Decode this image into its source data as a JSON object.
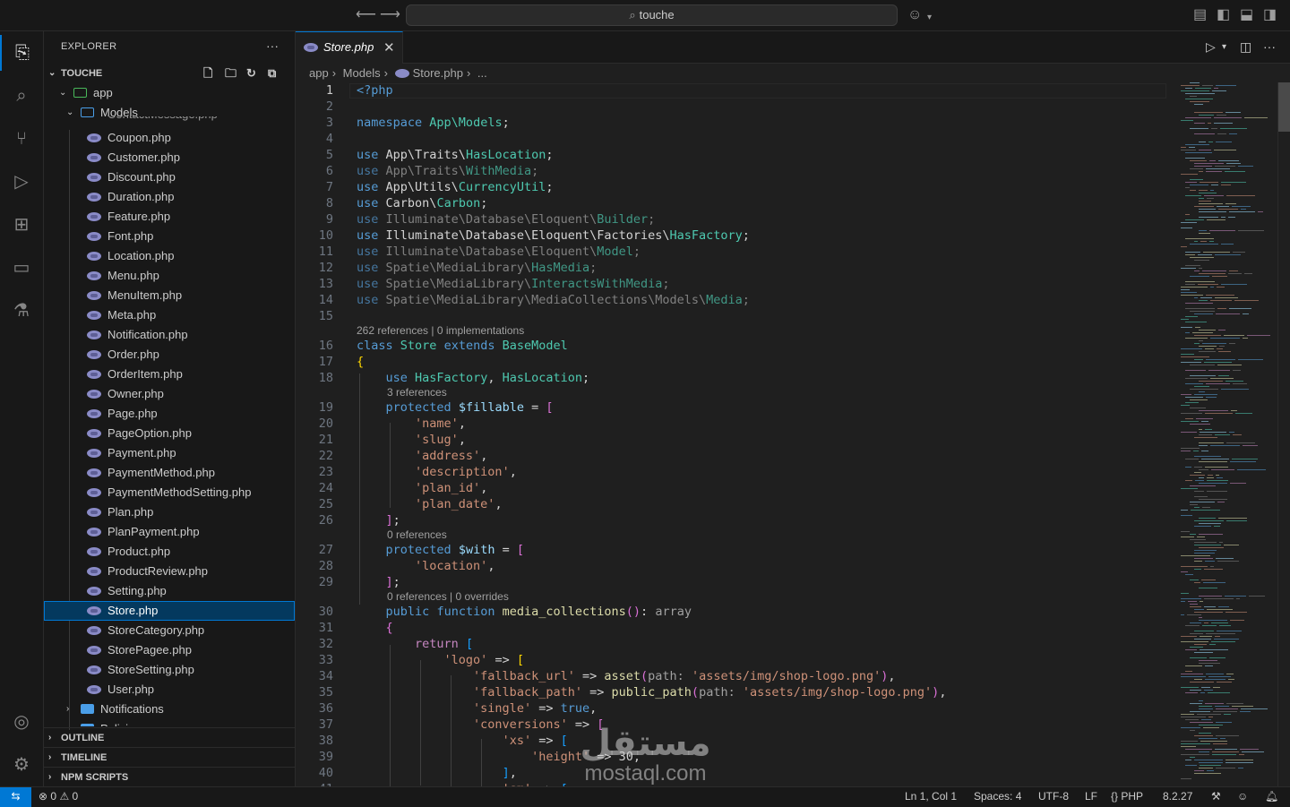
{
  "titlebar": {
    "search_text": "touche",
    "back_icon": "arrow-left-icon",
    "forward_icon": "arrow-right-icon"
  },
  "activitybar": [
    {
      "name": "explorer-icon",
      "glyph": "⎘",
      "active": true
    },
    {
      "name": "search-icon",
      "glyph": "⌕"
    },
    {
      "name": "source-control-icon",
      "glyph": "⑂"
    },
    {
      "name": "run-debug-icon",
      "glyph": "▷"
    },
    {
      "name": "extensions-icon",
      "glyph": "⊞"
    },
    {
      "name": "remote-explorer-icon",
      "glyph": "▭"
    },
    {
      "name": "testing-icon",
      "glyph": "⚗"
    }
  ],
  "sidebar": {
    "title": "EXPLORER",
    "project": "TOUCHE",
    "folders": {
      "app": "app",
      "models": "Models"
    },
    "partial_top": "ContactMessage.php",
    "files": [
      "Coupon.php",
      "Customer.php",
      "Discount.php",
      "Duration.php",
      "Feature.php",
      "Font.php",
      "Location.php",
      "Menu.php",
      "MenuItem.php",
      "Meta.php",
      "Notification.php",
      "Order.php",
      "OrderItem.php",
      "Owner.php",
      "Page.php",
      "PageOption.php",
      "Payment.php",
      "PaymentMethod.php",
      "PaymentMethodSetting.php",
      "Plan.php",
      "PlanPayment.php",
      "Product.php",
      "ProductReview.php",
      "Setting.php",
      "Store.php",
      "StoreCategory.php",
      "StorePagee.php",
      "StoreSetting.php",
      "User.php"
    ],
    "selected_file": "Store.php",
    "subfolder": "Notifications",
    "partial_bottom": "Policies",
    "sections": [
      "OUTLINE",
      "TIMELINE",
      "NPM SCRIPTS"
    ]
  },
  "editor": {
    "tab_label": "Store.php",
    "breadcrumb": [
      "app",
      "Models",
      "Store.php",
      "..."
    ],
    "current_line": 1,
    "lenses": {
      "16": "262 references | 0 implementations",
      "19": "3 references",
      "27": "0 references",
      "30": "0 references | 0 overrides"
    }
  },
  "statusbar": {
    "errors": "0",
    "warnings": "0",
    "position": "Ln 1, Col 1",
    "spaces": "Spaces: 4",
    "encoding": "UTF-8",
    "eol": "LF",
    "language": "PHP",
    "php_version": "8.2.27"
  },
  "watermark": {
    "arabic": "مستقل",
    "latin": "mostaql.com"
  },
  "colors": {
    "accent": "#0078d4",
    "selection": "#04395e",
    "keyword": "#569cd6",
    "type": "#4ec9b0",
    "string": "#ce9178"
  }
}
